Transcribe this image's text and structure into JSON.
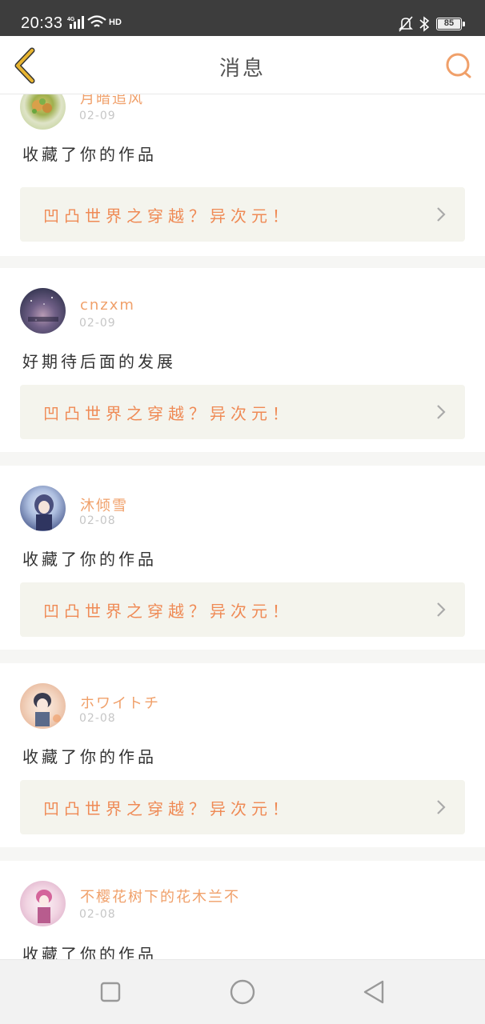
{
  "status_bar": {
    "time": "20:33",
    "network": "4G",
    "hd_label": "HD",
    "battery": "85",
    "icons": [
      "signal-icon",
      "wifi-icon",
      "bell-muted-icon",
      "bluetooth-icon",
      "battery-icon"
    ]
  },
  "header": {
    "title": "消息",
    "back_icon": "chevron-left-icon",
    "search_icon": "search-icon"
  },
  "colors": {
    "accent": "#f0a06a",
    "back_icon": "#e8b531",
    "work_title": "#ef8a55",
    "work_bg": "#f4f4ed"
  },
  "messages": [
    {
      "user": "月暗追风",
      "date": "02-09",
      "text": "收藏了你的作品",
      "work_title": "凹凸世界之穿越？异次元！"
    },
    {
      "user": "cnzxm",
      "date": "02-09",
      "text": "好期待后面的发展",
      "work_title": "凹凸世界之穿越？异次元！"
    },
    {
      "user": "沐倾雪",
      "date": "02-08",
      "text": "收藏了你的作品",
      "work_title": "凹凸世界之穿越？异次元！"
    },
    {
      "user": "ホワイトチ",
      "date": "02-08",
      "text": "收藏了你的作品",
      "work_title": "凹凸世界之穿越？异次元！"
    },
    {
      "user": "不樱花树下的花木兰不",
      "date": "02-08",
      "text": "收藏了你的作品"
    }
  ],
  "nav": {
    "icons": [
      "recent-apps-icon",
      "home-icon",
      "back-triangle-icon"
    ]
  }
}
